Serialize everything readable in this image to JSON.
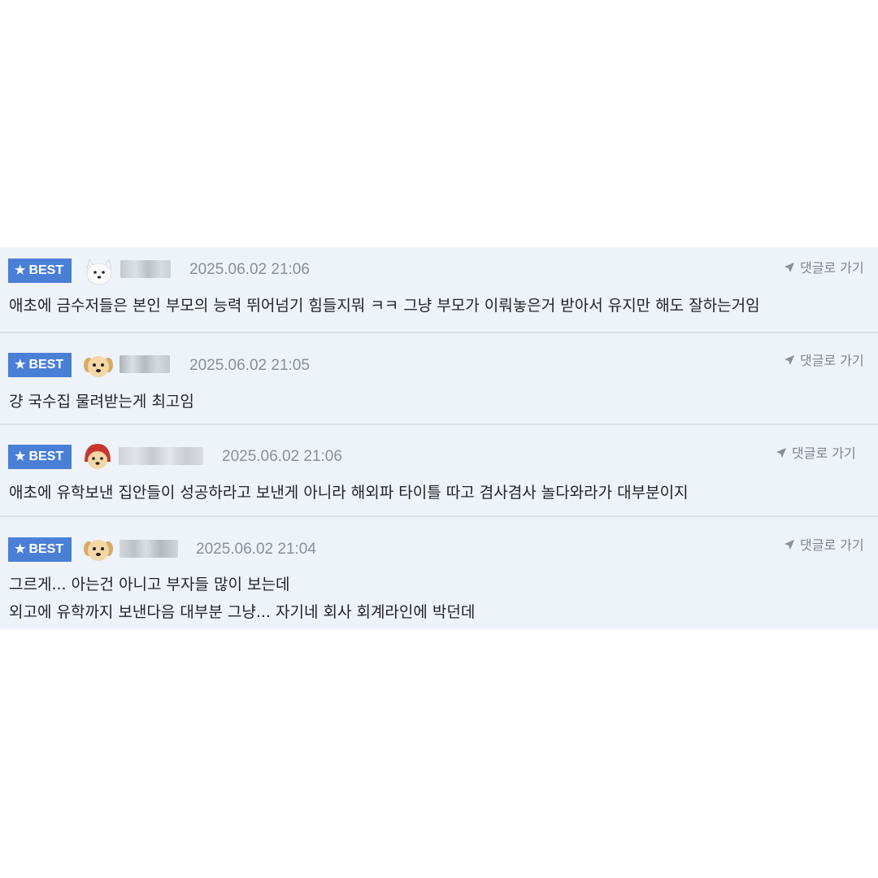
{
  "comments": [
    {
      "badge": "BEST",
      "avatar": "white-fox-avatar",
      "time": "2025.06.02 21:06",
      "goto": "댓글로 가기",
      "lines": [
        "애초에 금수저들은 본인 부모의 능력 뛰어넘기 힘들지뭐 ㅋㅋ 그냥 부모가 이뤄놓은거 받아서 유지만 해도 잘하는거임"
      ]
    },
    {
      "badge": "BEST",
      "avatar": "puppy-avatar",
      "time": "2025.06.02 21:05",
      "goto": "댓글로 가기",
      "lines": [
        "걍 국수집 물려받는게 최고임"
      ]
    },
    {
      "badge": "BEST",
      "avatar": "puppy-red-hood-avatar",
      "time": "2025.06.02 21:06",
      "goto": "댓글로 가기",
      "lines": [
        "애초에 유학보낸 집안들이 성공하라고 보낸게 아니라 해외파 타이틀 따고 겸사겸사 놀다와라가 대부분이지"
      ]
    },
    {
      "badge": "BEST",
      "avatar": "puppy-avatar",
      "time": "2025.06.02 21:04",
      "goto": "댓글로 가기",
      "lines": [
        "그르게... 아는건 아니고 부자들 많이 보는데",
        "외고에 유학까지 보낸다음 대부분 그냥... 자기네 회사 회계라인에 박던데"
      ]
    }
  ],
  "colors": {
    "badge_bg": "#4a7fd6",
    "panel_bg": "#eef2f9",
    "timestamp": "#8a8f98",
    "body_text": "#222428"
  }
}
